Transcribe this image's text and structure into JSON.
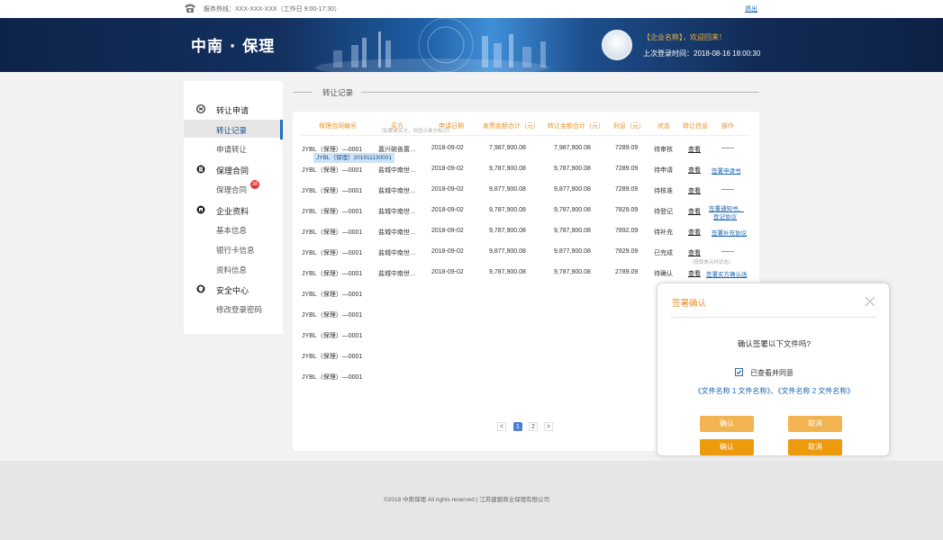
{
  "topbar": {
    "hotline": "服务热线：XXX-XXX-XXX（工作日 9:00-17:30）",
    "logout": "退出"
  },
  "header": {
    "logo": "中南 · 保理",
    "welcome": "【企业名称】，欢迎回来！",
    "last_login": "上次登录时间：2018-08-16  18:00:30"
  },
  "sidebar": {
    "groups": [
      {
        "label": "转让申请",
        "items": [
          {
            "label": "转让记录"
          },
          {
            "label": "申请转让"
          }
        ]
      },
      {
        "label": "保理合同",
        "items": [
          {
            "label": "保理合同",
            "badge": "38"
          }
        ]
      },
      {
        "label": "企业资料",
        "items": [
          {
            "label": "基本信息"
          },
          {
            "label": "银行卡信息"
          },
          {
            "label": "资料信息"
          }
        ]
      },
      {
        "label": "安全中心",
        "items": [
          {
            "label": "修改登录密码"
          }
        ]
      }
    ]
  },
  "main": {
    "section_title": "转让记录",
    "columns": [
      "保理合同编号",
      "买方",
      "申请日期",
      "发票金额合计（元）",
      "转让金额合计（元）",
      "利息（元）",
      "状态",
      "转让信息",
      "操作"
    ],
    "buyer_subnote": "（如果是买方，则显示单方标识）",
    "tooltip": "JYBL（保理）201911130001",
    "rows": [
      {
        "id": "JYBL（保理）—0001",
        "buyer": "嘉兴碗善置…",
        "date": "2018-09-02",
        "invoice": "7,987,900.08",
        "transfer": "7,987,900.08",
        "interest": "7289.09",
        "status": "待审核",
        "info": "查看",
        "action": "——"
      },
      {
        "id": "JYBL（保理）—0001",
        "buyer": "盐城中南世…",
        "date": "2018-09-02",
        "invoice": "9,787,900.08",
        "transfer": "9,787,900.08",
        "interest": "7289.09",
        "status": "待申请",
        "info": "查看",
        "action": "签署申请书"
      },
      {
        "id": "JYBL（保理）—0001",
        "buyer": "盐城中南世…",
        "date": "2018-09-02",
        "invoice": "9,877,900.08",
        "transfer": "9,877,900.08",
        "interest": "7289.09",
        "status": "待核准",
        "info": "查看",
        "action": "——"
      },
      {
        "id": "JYBL（保理）—0001",
        "buyer": "盐城中南世…",
        "date": "2018-09-02",
        "invoice": "9,787,900.08",
        "transfer": "9,787,900.08",
        "interest": "7829.09",
        "status": "待登记",
        "info": "查看",
        "action": "签署通知书、",
        "action2": "登记协议"
      },
      {
        "id": "JYBL（保理）—0001",
        "buyer": "盐城中南世…",
        "date": "2018-09-02",
        "invoice": "9,787,900.08",
        "transfer": "9,787,900.08",
        "interest": "7892.09",
        "status": "待补充",
        "info": "查看",
        "action": "签署补充协议"
      },
      {
        "id": "JYBL（保理）—0001",
        "buyer": "盐城中南世…",
        "date": "2018-09-02",
        "invoice": "9,877,900.08",
        "transfer": "9,877,900.08",
        "interest": "7829.09",
        "status": "已完成",
        "info": "查看",
        "action": "——"
      },
      {
        "id": "JYBL（保理）—0001",
        "buyer": "盐城中南世…",
        "date": "2018-09-02",
        "invoice": "9,787,900.08",
        "transfer": "9,787,900.08",
        "interest": "2789.09",
        "status": "待确认",
        "info": "查看",
        "action": "签署买方确认函"
      },
      {
        "id": "JYBL（保理）—0001"
      },
      {
        "id": "JYBL（保理）—0001"
      },
      {
        "id": "JYBL（保理）—0001"
      },
      {
        "id": "JYBL（保理）—0001"
      },
      {
        "id": "JYBL（保理）—0001"
      }
    ],
    "hint": "（获取焦点时状态）",
    "pagination": {
      "prev": "<",
      "pages": [
        "1",
        "2"
      ],
      "next": ">"
    }
  },
  "dialog": {
    "title": "签署确认",
    "question": "确认签署以下文件吗?",
    "checkbox_label": "已查看并同意",
    "files": "《文件名称 1 文件名称》、《文件名称 2 文件名称》",
    "confirm": "确认",
    "cancel": "取消"
  },
  "footer": {
    "text": "©2018 中南保理 All rights reserved  |  江苏建銀商业保理有限公司"
  },
  "colors": {
    "accent_orange": "#e8912a",
    "link_blue": "#1a66b3",
    "sidebar_active": "#1f6fbf",
    "button_orange": "#ee9a0d",
    "badge_red": "#e53333"
  }
}
